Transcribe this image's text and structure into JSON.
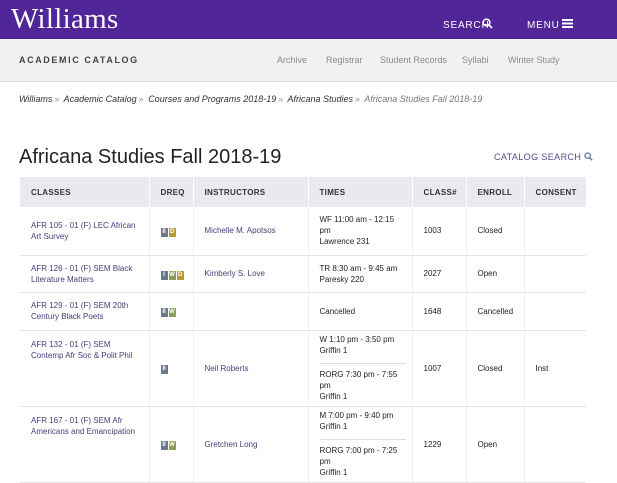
{
  "brand": {
    "logo": "Williams"
  },
  "top_nav": {
    "search": "SEARCH",
    "menu": "MENU"
  },
  "subnav": {
    "title": "ACADEMIC CATALOG",
    "links": [
      "Archive",
      "Registrar",
      "Student Records",
      "Syllabi",
      "Winter Study"
    ]
  },
  "breadcrumb": [
    "Williams",
    "Academic Catalog",
    "Courses and Programs 2018-19",
    "Africana Studies",
    "Africana Studies Fall 2018-19"
  ],
  "breadcrumb_sep": "»",
  "page": {
    "title": "Africana Studies Fall 2018-19",
    "catalog_search": "CATALOG SEARCH"
  },
  "table": {
    "headers": [
      "CLASSES",
      "DREQ",
      "INSTRUCTORS",
      "TIMES",
      "CLASS#",
      "ENROLL",
      "CONSENT"
    ],
    "rows": [
      {
        "course": "AFR 105 - 01 (F) LEC African Art Survey",
        "dreq": [
          "II",
          "D"
        ],
        "instructor": "Michelle M. Apotsos",
        "times": [
          [
            "WF 11:00 am - 12:15 pm",
            "Lawrence 231"
          ]
        ],
        "class_num": "1003",
        "enroll": "Closed",
        "consent": ""
      },
      {
        "course": "AFR 126 - 01 (F) SEM Black Literature Matters",
        "dreq": [
          "I",
          "W",
          "D"
        ],
        "instructor": "Kimberly S. Love",
        "times": [
          [
            "TR 8:30 am - 9:45 am",
            "Paresky 220"
          ]
        ],
        "class_num": "2027",
        "enroll": "Open",
        "consent": ""
      },
      {
        "course": "AFR 129 - 01 (F) SEM 20th Century Black Poets",
        "dreq": [
          "II",
          "W"
        ],
        "instructor": "",
        "times": [
          [
            "Cancelled"
          ]
        ],
        "class_num": "1648",
        "enroll": "Cancelled",
        "consent": ""
      },
      {
        "course": "AFR 132 - 01 (F) SEM Contemp Afr Soc & Polit Phil",
        "dreq": [
          "II"
        ],
        "instructor": "Neil Roberts",
        "times": [
          [
            "W 1:10 pm - 3:50 pm",
            "Griffin 1"
          ],
          [
            "RORG 7:30 pm - 7:55 pm",
            "Griffin 1"
          ]
        ],
        "class_num": "1007",
        "enroll": "Closed",
        "consent": "Inst"
      },
      {
        "course": "AFR 167 - 01 (F) SEM Afr Americans and Emancipation",
        "dreq": [
          "II",
          "W"
        ],
        "instructor": "Gretchen Long",
        "times": [
          [
            "M 7:00 pm - 9:40 pm",
            "Griffin 1"
          ],
          [
            "RORG 7:00 pm - 7:25 pm",
            "Griffin 1"
          ]
        ],
        "class_num": "1229",
        "enroll": "Open",
        "consent": ""
      }
    ]
  },
  "colors": {
    "brand_purple": "#512698",
    "link": "#4a3c7a",
    "header_bg": "#e8eaef"
  },
  "icons": {
    "search": "search-icon",
    "menu": "menu-icon"
  }
}
